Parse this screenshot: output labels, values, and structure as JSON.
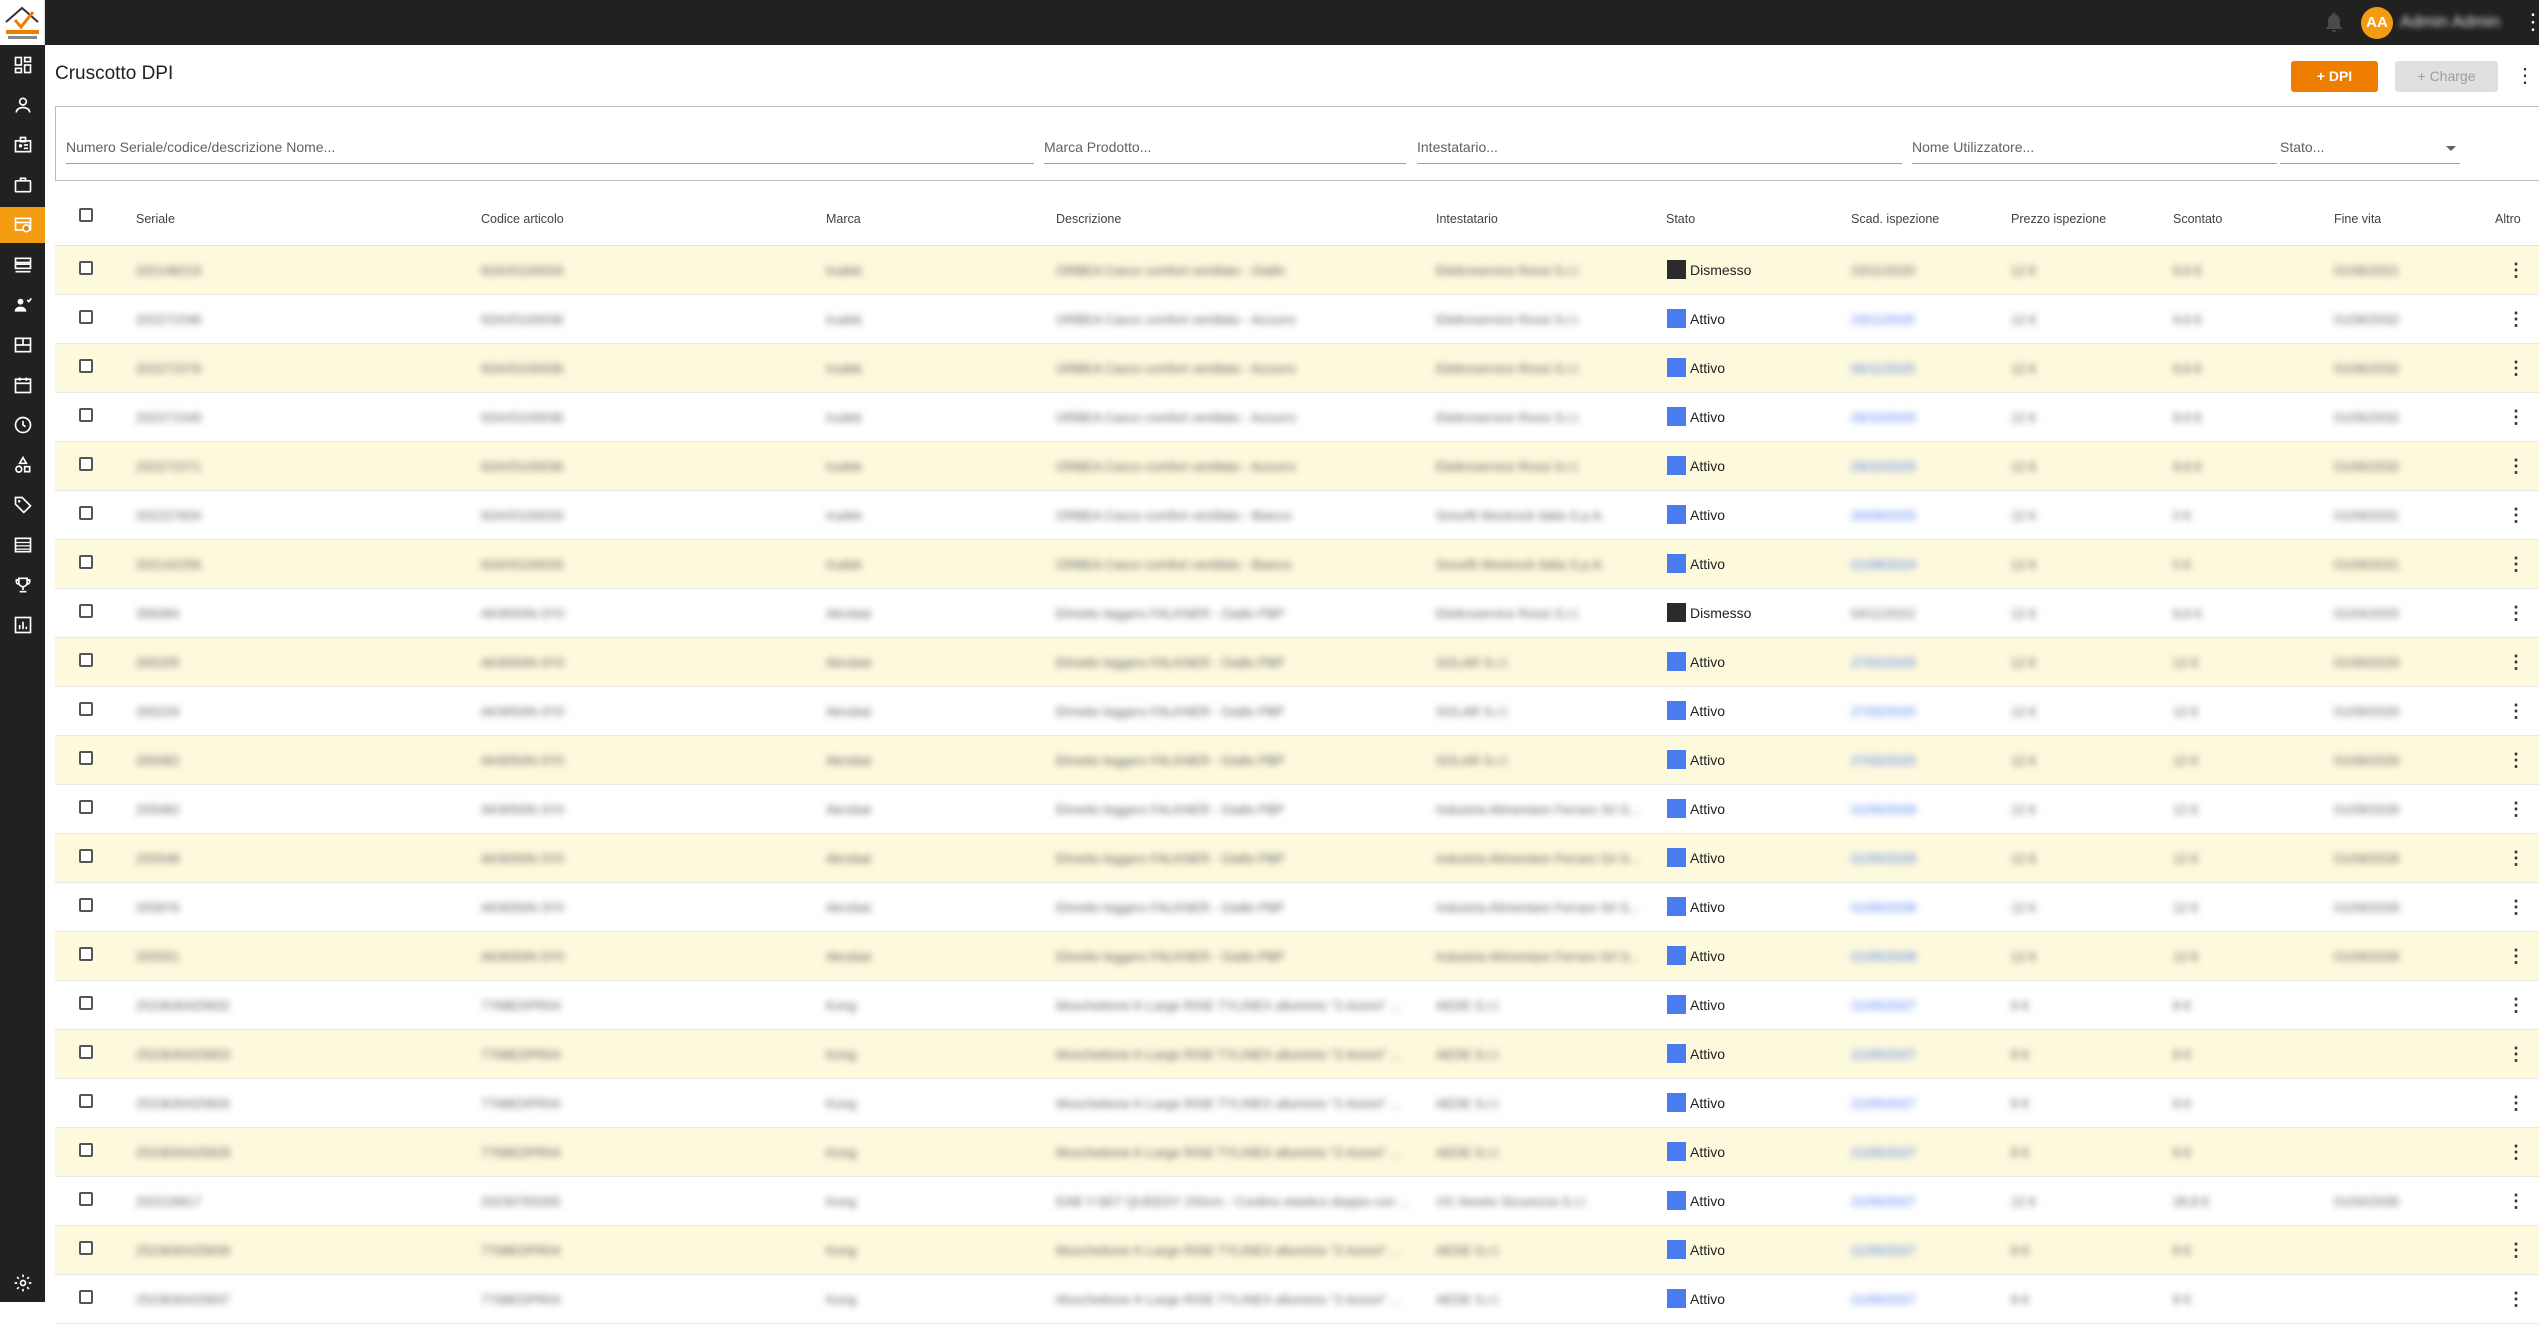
{
  "app": {
    "logo_text": "SAFETY SICUREZZA"
  },
  "topbar": {
    "avatar_initials": "AA",
    "user_name": "Admin Admin"
  },
  "colors": {
    "accent": "#ef7d00",
    "attivo": "#4a7cf0",
    "dismesso": "#2b2b2b",
    "row_highlight": "#fdf9dd"
  },
  "sidebar": {
    "items": [
      {
        "icon": "dashboard-icon"
      },
      {
        "icon": "person-icon"
      },
      {
        "icon": "badge-icon"
      },
      {
        "icon": "briefcase-icon"
      },
      {
        "icon": "dpi-icon",
        "active": true
      },
      {
        "icon": "storage-icon"
      },
      {
        "icon": "people-icon"
      },
      {
        "icon": "layout-icon"
      },
      {
        "icon": "calendar-icon"
      },
      {
        "icon": "clock-icon"
      },
      {
        "icon": "shapes-icon"
      },
      {
        "icon": "tag-icon"
      },
      {
        "icon": "list-icon"
      },
      {
        "icon": "trophy-icon"
      },
      {
        "icon": "chart-icon"
      }
    ],
    "settings_icon": "gear-icon"
  },
  "page": {
    "title": "Cruscotto DPI",
    "add_button": "+ DPI",
    "charge_button": "+ Charge"
  },
  "filters": {
    "serial": "Numero Seriale/codice/descrizione Nome...",
    "brand": "Marca Prodotto...",
    "holder": "Intestatario...",
    "user": "Nome Utilizzatore...",
    "status": "Stato..."
  },
  "table": {
    "columns": [
      "Seriale",
      "Codice articolo",
      "Marca",
      "Descrizione",
      "Intestatario",
      "Stato",
      "Scad. ispezione",
      "Prezzo ispezione",
      "Scontato",
      "Fine vita",
      "Altro"
    ],
    "rows": [
      {
        "seriale": "202148219",
        "codice": "92AX5100034",
        "marca": "Irudek",
        "descrizione": "ORBEA Casco comfort ventilato - Giallo",
        "intestatario": "Elettroservice Rossi S.r.l.",
        "stato": "Dismesso",
        "scad": "23/11/2020",
        "prezzo": "12 €",
        "scontato": "9,6 €",
        "fine": "01/06/2021"
      },
      {
        "seriale": "202271548",
        "codice": "92AX5100036",
        "marca": "Irudek",
        "descrizione": "ORBEA Casco comfort ventilato - Azzurro",
        "intestatario": "Elettroservice Rossi S.r.l.",
        "stato": "Attivo",
        "scad": "23/11/2025",
        "prezzo": "12 €",
        "scontato": "9,6 €",
        "fine": "01/06/2032"
      },
      {
        "seriale": "202271576",
        "codice": "92AX5100036",
        "marca": "Irudek",
        "descrizione": "ORBEA Casco comfort ventilato - Azzurro",
        "intestatario": "Elettroservice Rossi S.r.l.",
        "stato": "Attivo",
        "scad": "06/11/2025",
        "prezzo": "12 €",
        "scontato": "9,6 €",
        "fine": "01/06/2032"
      },
      {
        "seriale": "202271549",
        "codice": "92AX5100036",
        "marca": "Irudek",
        "descrizione": "ORBEA Casco comfort ventilato - Azzurro",
        "intestatario": "Elettroservice Rossi S.r.l.",
        "stato": "Attivo",
        "scad": "29/10/2025",
        "prezzo": "12 €",
        "scontato": "9,6 €",
        "fine": "01/06/2032"
      },
      {
        "seriale": "202271571",
        "codice": "92AX5100036",
        "marca": "Irudek",
        "descrizione": "ORBEA Casco comfort ventilato - Azzurro",
        "intestatario": "Elettroservice Rossi S.r.l.",
        "stato": "Attivo",
        "scad": "29/10/2025",
        "prezzo": "12 €",
        "scontato": "9,6 €",
        "fine": "01/06/2032"
      },
      {
        "seriale": "202157604",
        "codice": "92AX5100033",
        "marca": "Irudek",
        "descrizione": "ORBEA Casco comfort ventilato - Bianco",
        "intestatario": "Smurfit Westrock Italia S.p.A.",
        "stato": "Attivo",
        "scad": "20/09/2025",
        "prezzo": "12 €",
        "scontato": "0 €",
        "fine": "01/09/2031"
      },
      {
        "seriale": "202142256",
        "codice": "92AX5100033",
        "marca": "Irudek",
        "descrizione": "ORBEA Casco comfort ventilato - Bianco",
        "intestatario": "Smurfit Westrock Italia S.p.A.",
        "stato": "Attivo",
        "scad": "01/08/2024",
        "prezzo": "12 €",
        "scontato": "0 €",
        "fine": "01/09/2031"
      },
      {
        "seriale": "356084",
        "codice": "AK9050N-3Y0",
        "marca": "Akrobat",
        "descrizione": "Elmetto leggero FALKNER - Giallo PBP",
        "intestatario": "Elettroservice Rossi S.r.l.",
        "stato": "Dismesso",
        "scad": "04/11/2022",
        "prezzo": "12 €",
        "scontato": "9,6 €",
        "fine": "01/04/2025"
      },
      {
        "seriale": "265205",
        "codice": "AK9050N-3Y0",
        "marca": "Akrobat",
        "descrizione": "Elmetto leggero FALKNER - Giallo PBP",
        "intestatario": "SOLAR S.r.l.",
        "stato": "Attivo",
        "scad": "27/02/2025",
        "prezzo": "12 €",
        "scontato": "12 €",
        "fine": "01/09/2029"
      },
      {
        "seriale": "265229",
        "codice": "AK9050N-3Y0",
        "marca": "Akrobat",
        "descrizione": "Elmetto leggero FALKNER - Giallo PBP",
        "intestatario": "SOLAR S.r.l.",
        "stato": "Attivo",
        "scad": "27/02/2025",
        "prezzo": "12 €",
        "scontato": "12 €",
        "fine": "01/09/2029"
      },
      {
        "seriale": "265082",
        "codice": "AK9050N-3Y0",
        "marca": "Akrobat",
        "descrizione": "Elmetto leggero FALKNER - Giallo PBP",
        "intestatario": "SOLAR S.r.l.",
        "stato": "Attivo",
        "scad": "27/02/2025",
        "prezzo": "12 €",
        "scontato": "12 €",
        "fine": "01/09/2029"
      },
      {
        "seriale": "205082",
        "codice": "AK9050N-3Y0",
        "marca": "Akrobat",
        "descrizione": "Elmetto leggero FALKNER - Giallo PBP",
        "intestatario": "Industria Alimentare Ferraro Srl S...",
        "stato": "Attivo",
        "scad": "01/05/2028",
        "prezzo": "12 €",
        "scontato": "12 €",
        "fine": "01/09/2028"
      },
      {
        "seriale": "205548",
        "codice": "AK9050N-3Y0",
        "marca": "Akrobat",
        "descrizione": "Elmetto leggero FALKNER - Giallo PBP",
        "intestatario": "Industria Alimentare Ferraro Srl S...",
        "stato": "Attivo",
        "scad": "01/05/2028",
        "prezzo": "12 €",
        "scontato": "12 €",
        "fine": "01/09/2028"
      },
      {
        "seriale": "205876",
        "codice": "AK9050N-3Y0",
        "marca": "Akrobat",
        "descrizione": "Elmetto leggero FALKNER - Giallo PBP",
        "intestatario": "Industria Alimentare Ferraro Srl S...",
        "stato": "Attivo",
        "scad": "01/05/2028",
        "prezzo": "12 €",
        "scontato": "12 €",
        "fine": "01/09/2028"
      },
      {
        "seriale": "205551",
        "codice": "AK9050N-3Y0",
        "marca": "Akrobat",
        "descrizione": "Elmetto leggero FALKNER - Giallo PBP",
        "intestatario": "Industria Alimentare Ferraro Srl S...",
        "stato": "Attivo",
        "scad": "01/05/2028",
        "prezzo": "12 €",
        "scontato": "12 €",
        "fine": "01/09/2028"
      },
      {
        "seriale": "2523630425832",
        "codice": "7768EDPR04",
        "marca": "Kong",
        "descrizione": "Moschettone K-Large RISE TYLINEX alluminio \"2-Azioni\" ...",
        "intestatario": "AEDE S.r.l.",
        "stato": "Attivo",
        "scad": "21/05/2027",
        "prezzo": "8 €",
        "scontato": "8 €",
        "fine": ""
      },
      {
        "seriale": "2523630425853",
        "codice": "7768EDPR04",
        "marca": "Kong",
        "descrizione": "Moschettone K-Large RISE TYLINEX alluminio \"2-Azioni\" ...",
        "intestatario": "AEDE S.r.l.",
        "stato": "Attivo",
        "scad": "21/05/2027",
        "prezzo": "8 €",
        "scontato": "8 €",
        "fine": ""
      },
      {
        "seriale": "2523630425826",
        "codice": "7768EDPR04",
        "marca": "Kong",
        "descrizione": "Moschettone K-Large RISE TYLINEX alluminio \"2-Azioni\" ...",
        "intestatario": "AEDE S.r.l.",
        "stato": "Attivo",
        "scad": "21/05/2027",
        "prezzo": "8 €",
        "scontato": "8 €",
        "fine": ""
      },
      {
        "seriale": "2523630425828",
        "codice": "7768EDPR04",
        "marca": "Kong",
        "descrizione": "Moschettone K-Large RISE TYLINEX alluminio \"2-Azioni\" ...",
        "intestatario": "AEDE S.r.l.",
        "stato": "Attivo",
        "scad": "21/05/2027",
        "prezzo": "8 €",
        "scontato": "8 €",
        "fine": ""
      },
      {
        "seriale": "202218917",
        "codice": "20230783265",
        "marca": "Kong",
        "descrizione": "EAB Y-SET QUEEDY 150cm - Cordino elastico doppio con ...",
        "intestatario": "VS Veneto Sicurezza S.r.l.",
        "stato": "Attivo",
        "scad": "21/05/2027",
        "prezzo": "12 €",
        "scontato": "28,8 €",
        "fine": "01/04/2036"
      },
      {
        "seriale": "2523630425839",
        "codice": "7768EDPR04",
        "marca": "Kong",
        "descrizione": "Moschettone K-Large RISE TYLINEX alluminio \"2-Azioni\" ...",
        "intestatario": "AEDE S.r.l.",
        "stato": "Attivo",
        "scad": "21/05/2027",
        "prezzo": "8 €",
        "scontato": "8 €",
        "fine": ""
      },
      {
        "seriale": "2523630425837",
        "codice": "7768EDPR04",
        "marca": "Kong",
        "descrizione": "Moschettone K-Large RISE TYLINEX alluminio \"2-Azioni\" ...",
        "intestatario": "AEDE S.r.l.",
        "stato": "Attivo",
        "scad": "21/05/2027",
        "prezzo": "8 €",
        "scontato": "8 €",
        "fine": ""
      }
    ]
  }
}
